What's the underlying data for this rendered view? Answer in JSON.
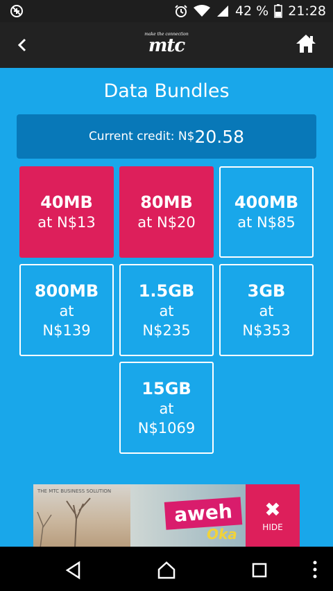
{
  "status_bar": {
    "battery_percent": "42 %",
    "time": "21:28",
    "icons": [
      "no-signal-icon",
      "alarm-icon",
      "wifi-icon",
      "cell-signal-icon",
      "battery-icon"
    ]
  },
  "app_bar": {
    "back_icon": "chevron-left-icon",
    "logo_tagline": "make the connection",
    "logo_text": "mtc",
    "home_icon": "home-icon"
  },
  "page": {
    "title": "Data Bundles",
    "credit_label": "Current credit: N$",
    "credit_amount": "20.58"
  },
  "bundles": [
    {
      "size": "40MB",
      "price": "at N$13",
      "selected": true
    },
    {
      "size": "80MB",
      "price": "at N$20",
      "selected": true
    },
    {
      "size": "400MB",
      "price": "at N$85",
      "selected": false
    },
    {
      "size": "800MB",
      "price_at": "at",
      "price_amount": "N$139",
      "selected": false
    },
    {
      "size": "1.5GB",
      "price_at": "at",
      "price_amount": "N$235",
      "selected": false
    },
    {
      "size": "3GB",
      "price_at": "at",
      "price_amount": "N$353",
      "selected": false
    },
    {
      "size": "15GB",
      "price_at": "at",
      "price_amount": "N$1069",
      "selected": false
    }
  ],
  "ad": {
    "caption": "THE MTC BUSINESS SOLUTION",
    "brand_text": "aweh",
    "sub_text": "Oka",
    "hide_label": "HIDE"
  },
  "colors": {
    "background": "#19a7ea",
    "credit_box": "#0878b8",
    "selected_tile": "#dd1f5b",
    "app_bar": "#222222"
  },
  "nav_bar": {
    "icons": [
      "back-triangle-icon",
      "home-circle-icon",
      "recents-square-icon",
      "more-vert-icon"
    ]
  }
}
